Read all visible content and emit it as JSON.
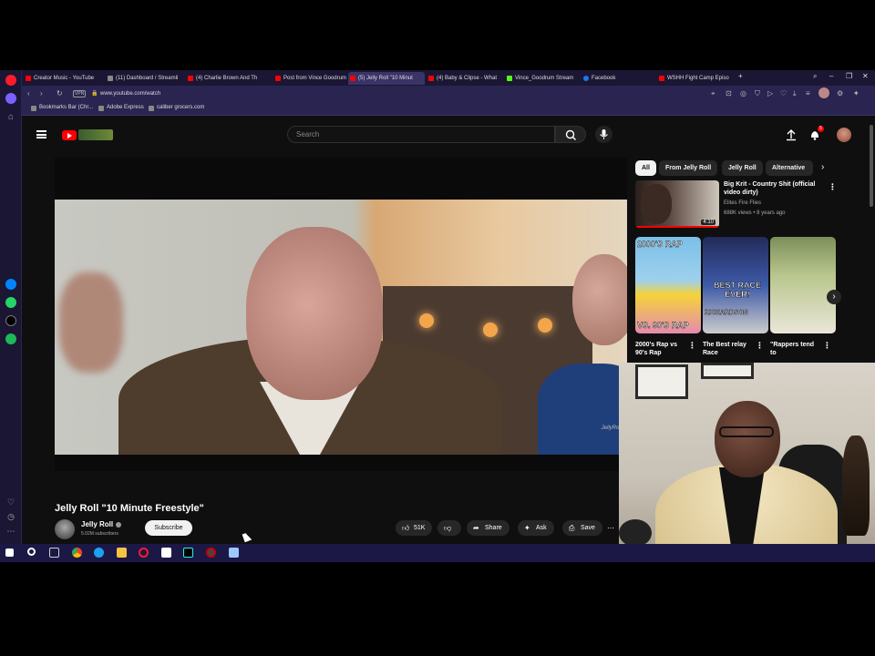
{
  "browser": {
    "tabs": [
      {
        "label": "Creator Music - YouTube",
        "color": "#ff0000"
      },
      {
        "label": "(11) Dashboard / Streamli",
        "color": "#888888"
      },
      {
        "label": "(4) Charlie Brown And Th",
        "color": "#ff0000"
      },
      {
        "label": "Post from Vince Goodrum",
        "color": "#ff0000"
      },
      {
        "label": "(5) Jelly Roll \"10 Minut",
        "color": "#ff0000"
      },
      {
        "label": "(4) Baby & Clipse - What",
        "color": "#ff0000"
      },
      {
        "label": "Vince_Goodrum Stream",
        "color": "#53fc18"
      },
      {
        "label": "Facebook",
        "color": "#1877f2"
      },
      {
        "label": "WSHH Fight Camp Episo",
        "color": "#ff0000"
      }
    ],
    "active_tab_index": 4,
    "url": "www.youtube.com/watch",
    "vpn_label": "VPN",
    "bookmarks": [
      "Bookmarks Bar (Chr...",
      "Adobe Express",
      "caliber grocers.com"
    ]
  },
  "youtube": {
    "search_placeholder": "Search",
    "notification_count": "5",
    "video": {
      "title": "Jelly Roll \"10 Minute Freestyle\"",
      "channel": "Jelly Roll",
      "subscribers": "5.02M subscribers",
      "subscribe_label": "Subscribe",
      "likes": "51K",
      "share_label": "Share",
      "ask_label": "Ask",
      "save_label": "Save",
      "watermark": "JellyRoll"
    },
    "chips": [
      "All",
      "From Jelly Roll",
      "Jelly Roll",
      "Alternative"
    ],
    "recommendation": {
      "title": "Big Krit - Country Shit (official video dirty)",
      "channel": "Elites Fire Flies",
      "meta": "688K views • 8 years ago",
      "duration": "4:10"
    },
    "shorts": [
      {
        "overlay_top": "2000'S RAP",
        "overlay_bottom": "VS. 90'S RAP",
        "title": "2000's Rap vs 90's Rap"
      },
      {
        "overlay_top": "BEST RACE EVER!",
        "overlay_bottom": "RICHARDSON",
        "title": "The Best relay Race"
      },
      {
        "overlay_top": "",
        "overlay_bottom": "",
        "title": "\"Rappers tend to"
      }
    ]
  }
}
